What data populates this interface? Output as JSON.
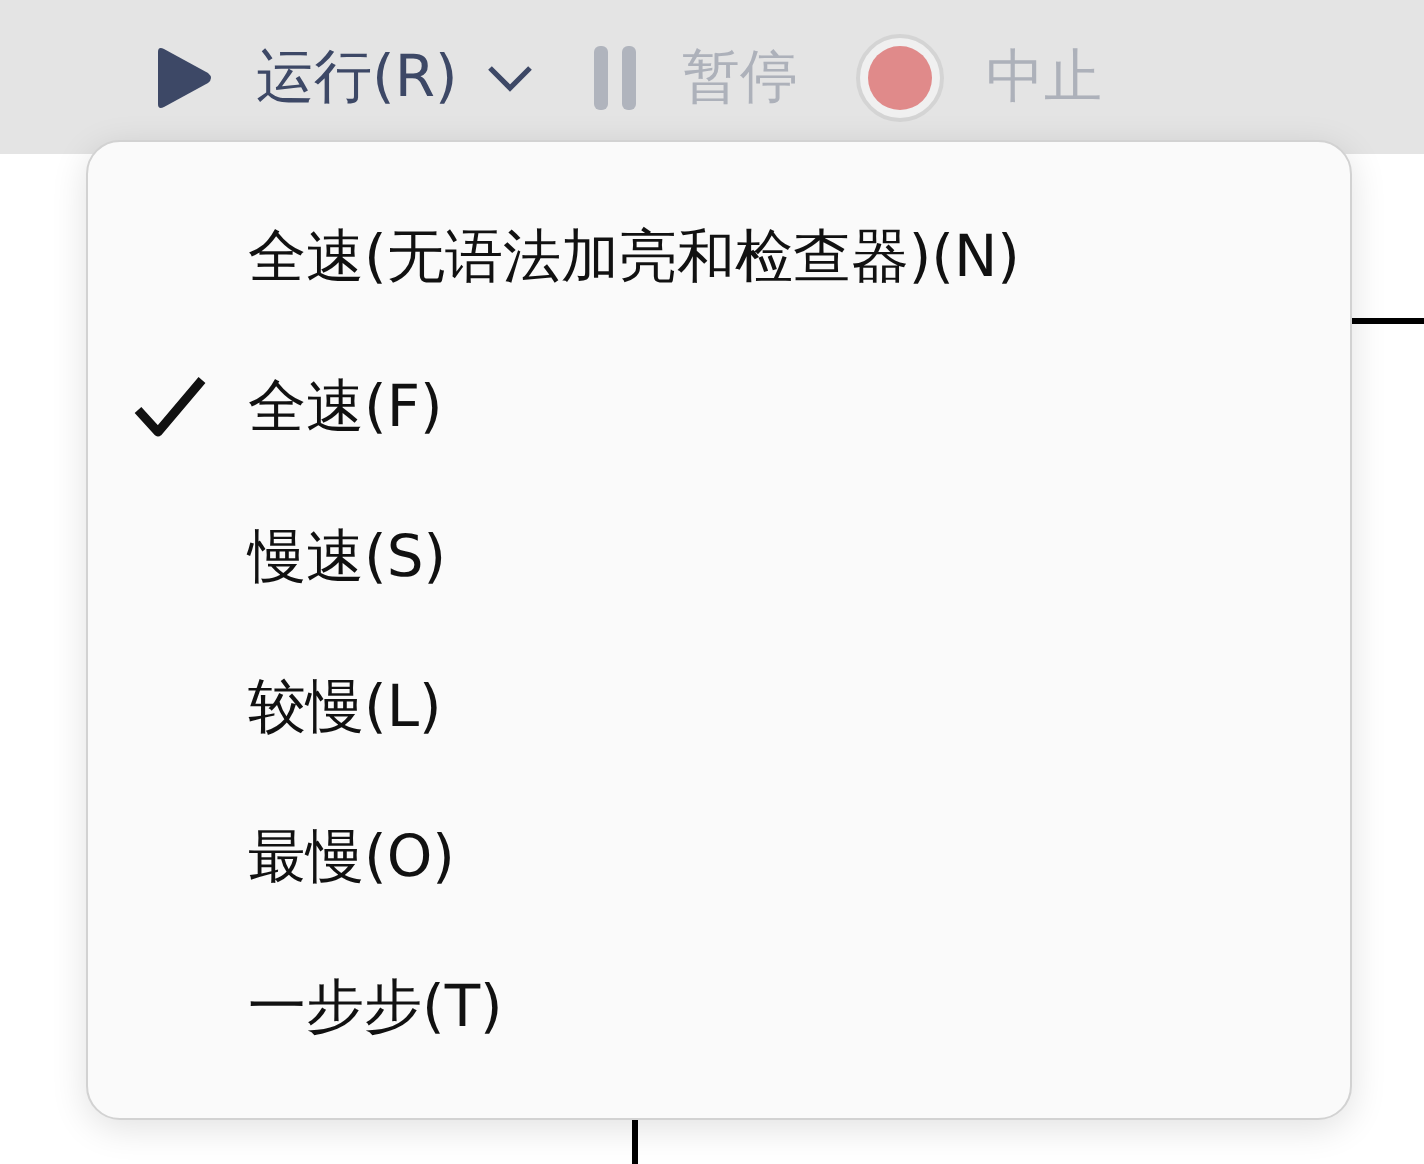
{
  "toolbar": {
    "buttons": [
      {
        "kind": "run",
        "label": "运行(R)",
        "disabled": false,
        "has_dropdown": true
      },
      {
        "kind": "pause",
        "label": "暂停",
        "disabled": true,
        "has_dropdown": false
      },
      {
        "kind": "stop",
        "label": "中止",
        "disabled": true,
        "has_dropdown": false
      }
    ]
  },
  "speed_menu": {
    "items": [
      {
        "label": "全速(无语法加亮和检查器)(N)",
        "checked": false
      },
      {
        "label": "全速(F)",
        "checked": true
      },
      {
        "label": "慢速(S)",
        "checked": false
      },
      {
        "label": "较慢(L)",
        "checked": false
      },
      {
        "label": "最慢(O)",
        "checked": false
      },
      {
        "label": "一步步(T)",
        "checked": false
      }
    ]
  }
}
